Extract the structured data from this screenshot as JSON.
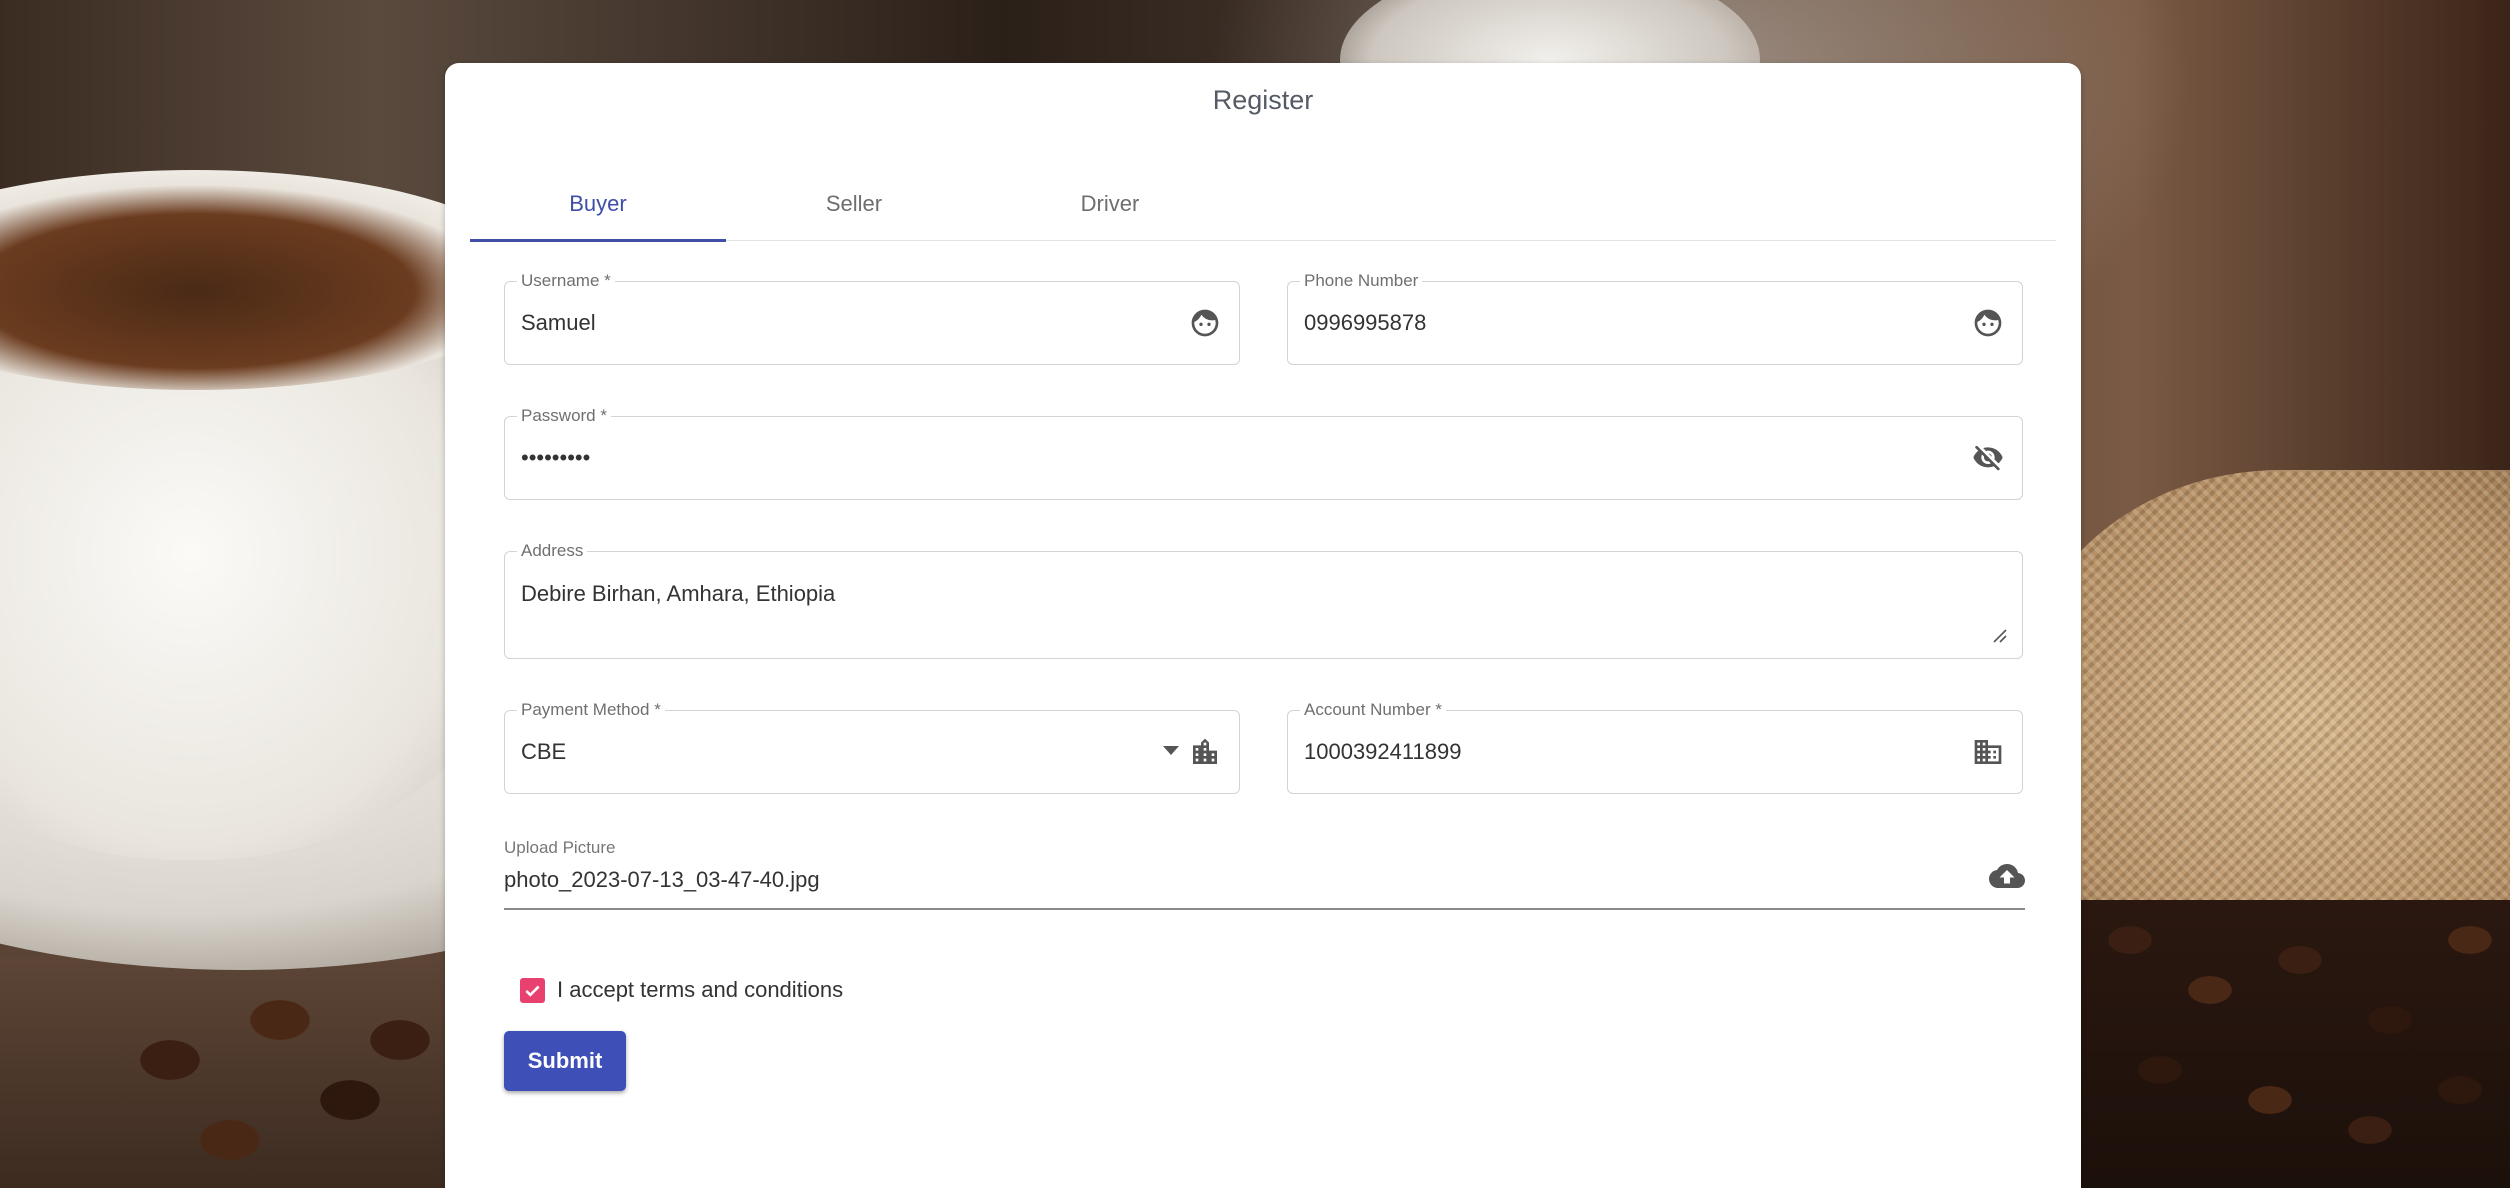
{
  "form": {
    "title": "Register",
    "tabs": [
      {
        "label": "Buyer",
        "active": true
      },
      {
        "label": "Seller",
        "active": false
      },
      {
        "label": "Driver",
        "active": false
      }
    ],
    "fields": {
      "username": {
        "label": "Username *",
        "value": "Samuel",
        "icon": "face-icon"
      },
      "phone": {
        "label": "Phone Number",
        "value": "0996995878",
        "icon": "face-icon"
      },
      "password": {
        "label": "Password *",
        "value": "•••••••••",
        "icon": "visibility-off-icon"
      },
      "address": {
        "label": "Address",
        "value": "Debire Birhan, Amhara, Ethiopia"
      },
      "payment": {
        "label": "Payment Method *",
        "value": "CBE",
        "icon": "location-city-icon"
      },
      "account": {
        "label": "Account Number *",
        "value": "1000392411899",
        "icon": "business-icon"
      }
    },
    "upload": {
      "label": "Upload Picture",
      "value": "photo_2023-07-13_03-47-40.jpg",
      "icon": "cloud-upload-icon"
    },
    "terms": {
      "label": "I accept terms and conditions",
      "checked": true
    },
    "submit_label": "Submit"
  },
  "colors": {
    "accent": "#3f4fa8",
    "button": "#3f4fb8",
    "checkbox": "#e8406f"
  }
}
